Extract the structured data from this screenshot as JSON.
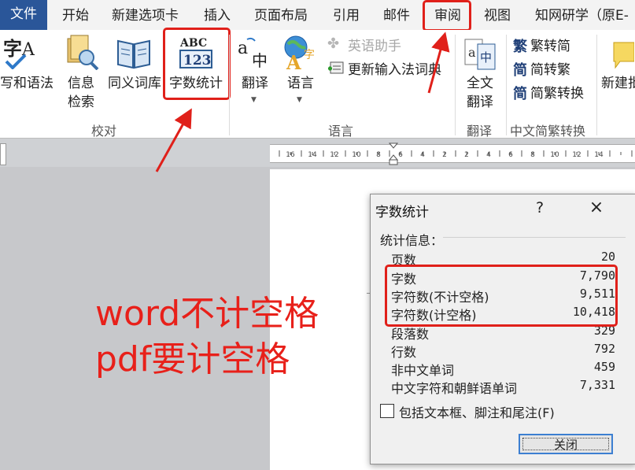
{
  "tabs": [
    "文件",
    "开始",
    "新建选项卡",
    "插入",
    "页面布局",
    "引用",
    "邮件",
    "审阅",
    "视图",
    "知网研学（原E-"
  ],
  "ribbon": {
    "proofing": {
      "spelling_label": "写和语法",
      "research_label_1": "信息",
      "research_label_2": "检索",
      "thesaurus_label": "同义词库",
      "wordcount_label": "字数统计",
      "wordcount_icon_top": "ABC",
      "wordcount_icon_bottom": "123",
      "group_label": "校对"
    },
    "language": {
      "translate_label": "翻译",
      "language_label": "语言",
      "english_assistant_label": "英语助手",
      "update_ime_label": "更新输入法词典",
      "group_label": "语言"
    },
    "translate_group": {
      "full_text_1": "全文",
      "full_text_2": "翻译",
      "group_label": "翻译"
    },
    "chinese_conversion": {
      "to_simplified": "繁转简",
      "to_traditional": "简转繁",
      "convert": "简繁转换",
      "group_label": "中文简繁转换",
      "glyph_trad": "繁",
      "glyph_simp": "简",
      "glyph_conv": "简"
    },
    "comments": {
      "new_label": "新建批"
    }
  },
  "dialog": {
    "title": "字数统计",
    "help": "?",
    "close_glyph": "×",
    "section_label": "统计信息：",
    "stats": [
      {
        "label": "页数",
        "value": "20"
      },
      {
        "label": "字数",
        "value": "7,790"
      },
      {
        "label": "字符数(不计空格)",
        "value": "9,511"
      },
      {
        "label": "字符数(计空格)",
        "value": "10,418"
      },
      {
        "label": "段落数",
        "value": "329"
      },
      {
        "label": "行数",
        "value": "792"
      },
      {
        "label": "非中文单词",
        "value": "459"
      },
      {
        "label": "中文字符和朝鲜语单词",
        "value": "7,331"
      }
    ],
    "include_checkbox_label": "包括文本框、脚注和尾注(F)",
    "close_button_label": "关闭"
  },
  "annotation": {
    "line1": "word不计空格",
    "line2": "pdf要计空格"
  },
  "ruler_numbers": [
    "16",
    "14",
    "12",
    "10",
    "8",
    "6",
    "4",
    "2",
    "2",
    "4",
    "6",
    "8",
    "10",
    "12",
    "14"
  ],
  "colors": {
    "accent_red": "#e0201a",
    "file_tab": "#2a5699"
  }
}
